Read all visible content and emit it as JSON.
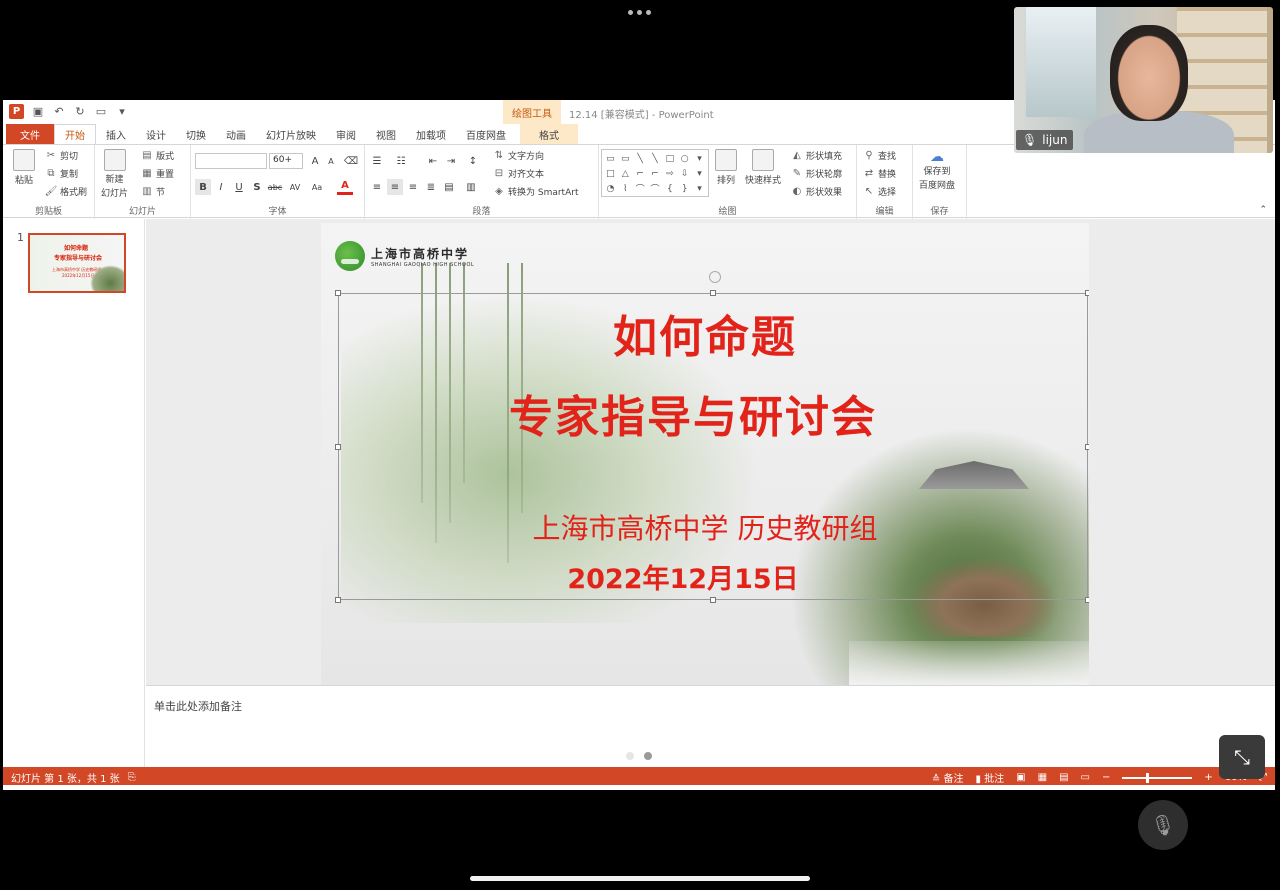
{
  "app": {
    "doc_title": "12.14 [兼容模式] - PowerPoint",
    "context_tab_label": "绘图工具"
  },
  "tabs": [
    {
      "label": "文件"
    },
    {
      "label": "开始"
    },
    {
      "label": "插入"
    },
    {
      "label": "设计"
    },
    {
      "label": "切换"
    },
    {
      "label": "动画"
    },
    {
      "label": "幻灯片放映"
    },
    {
      "label": "审阅"
    },
    {
      "label": "视图"
    },
    {
      "label": "加载项"
    },
    {
      "label": "百度网盘"
    },
    {
      "label": "格式"
    }
  ],
  "ribbon": {
    "clipboard": {
      "label": "剪贴板",
      "paste": "粘贴",
      "cut": "剪切",
      "copy": "复制",
      "format_painter": "格式刷"
    },
    "slides": {
      "label": "幻灯片",
      "new_slide_1": "新建",
      "new_slide_2": "幻灯片",
      "layout": "版式",
      "reset": "重置",
      "section": "节"
    },
    "font": {
      "label": "字体",
      "font_name": "",
      "font_size": "60+"
    },
    "paragraph": {
      "label": "段落",
      "text_direction": "文字方向",
      "align_text": "对齐文本",
      "smartart": "转换为 SmartArt"
    },
    "drawing": {
      "label": "绘图",
      "arrange": "排列",
      "quick_styles": "快速样式",
      "shape_fill": "形状填充",
      "shape_outline": "形状轮廓",
      "shape_effects": "形状效果"
    },
    "editing": {
      "label": "编辑",
      "find": "查找",
      "replace": "替换",
      "select": "选择"
    },
    "save": {
      "label": "保存",
      "save_to_1": "保存到",
      "save_to_2": "百度网盘"
    }
  },
  "thumbnail": {
    "number": "1",
    "line1": "如何命题",
    "line2": "专家指导与研讨会",
    "line3": "上海市高桥中学 历史教研组",
    "line4": "2022年12月15日"
  },
  "slide": {
    "school_name_cn": "上海市高桥中学",
    "school_name_en": "SHANGHAI GAOQIAO HIGH SCHOOL",
    "title_line1": "如何命题",
    "title_line2": "专家指导与研讨会",
    "subtitle": "上海市高桥中学 历史教研组",
    "date": "2022年12月15日"
  },
  "notes": {
    "placeholder": "单击此处添加备注"
  },
  "statusbar": {
    "slide_info": "幻灯片 第 1 张，共 1 张",
    "notes_label": "备注",
    "comments_label": "批注",
    "zoom": "60%"
  },
  "video": {
    "participant_name": "lijun"
  },
  "colors": {
    "accent": "#d24726",
    "slide_title": "#e2231a"
  }
}
